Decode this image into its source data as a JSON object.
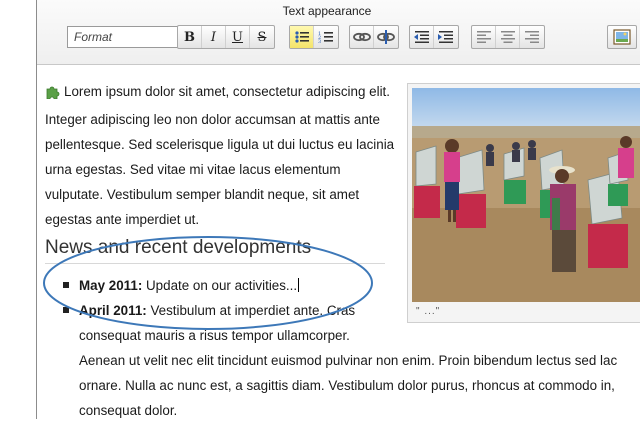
{
  "toolbar": {
    "title": "Text appearance",
    "format_value": "Format",
    "buttons": {
      "bold": "B",
      "italic": "I",
      "underline": "U",
      "strike": "S"
    }
  },
  "content": {
    "paragraph": "Lorem ipsum dolor sit amet, consectetur adipiscing elit. Integer adipiscing leo non dolor accumsan at mattis ante pellentesque. Sed scelerisque ligula ut dui luctus eu lacinia urna egestas. Sed vitae mi vitae lacus elementum vulputate. Vestibulum semper blandit neque, sit amet egestas ante imperdiet ut.",
    "heading": "News and recent developments",
    "items": [
      {
        "date": "May 2011:",
        "text": " Update on our activities..."
      },
      {
        "date": "April 2011:",
        "text": " Vestibulum at imperdiet ante. Cras"
      }
    ],
    "continuation": [
      "consequat mauris a risus tempor ullamcorper.",
      "Aenean ut velit nec elit tincidunt euismod pulvinar non enim. Proin bibendum lectus sed lac",
      "ornare. Nulla ac nunc est, a sagittis diam. Vestibulum dolor purus, rhoncus at commodo in,",
      "consequat dolor."
    ],
    "image_caption": "\" ...\""
  },
  "colors": {
    "active_button": "#f4e46a",
    "annotation_ellipse": "#3d78b8"
  }
}
